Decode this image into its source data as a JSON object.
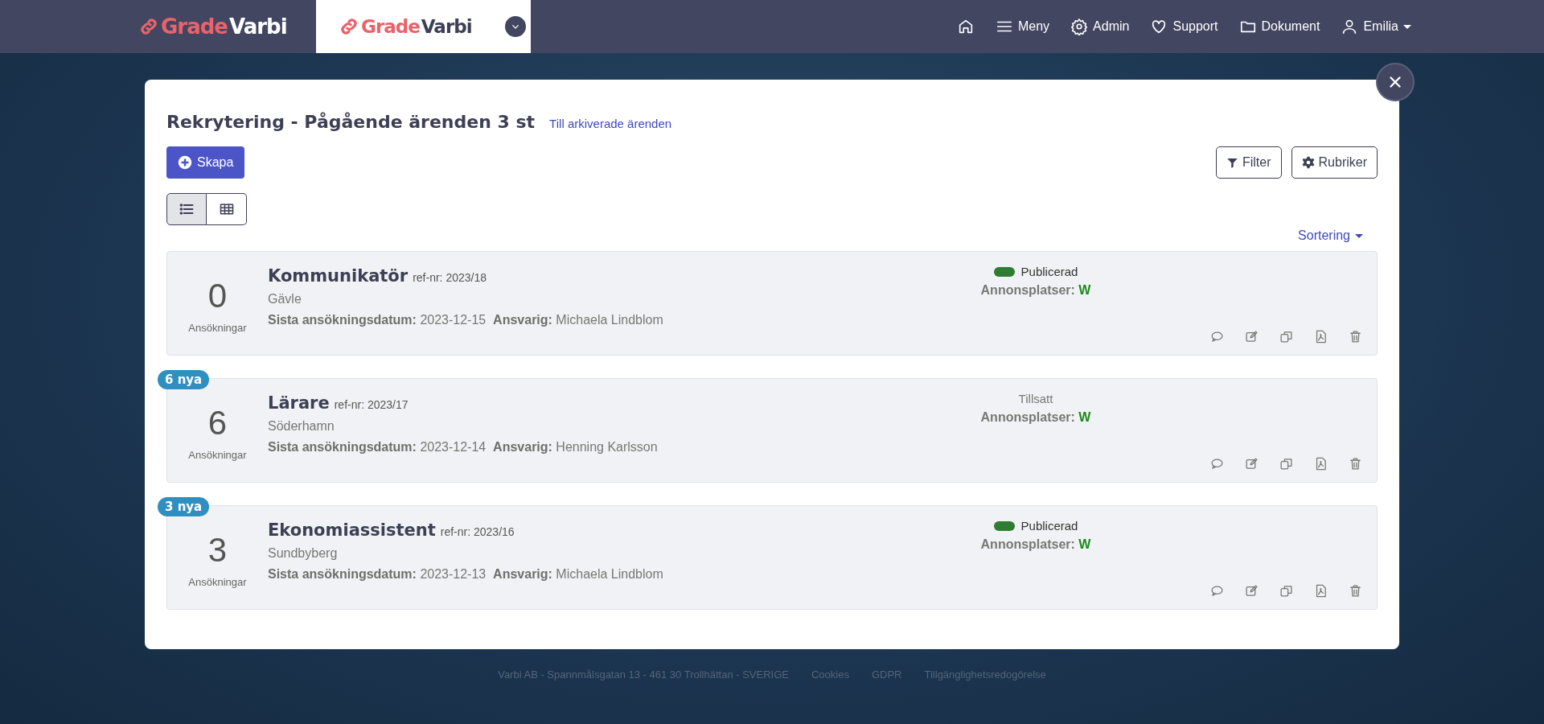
{
  "header": {
    "logo": {
      "first": "Grade",
      "second": "Varbi"
    },
    "tab_logo": {
      "first": "Grade",
      "second": "Varbi"
    },
    "nav": [
      {
        "kind": "home"
      },
      {
        "kind": "menu",
        "label": "Meny"
      },
      {
        "kind": "gear",
        "label": "Admin"
      },
      {
        "kind": "heart",
        "label": "Support"
      },
      {
        "kind": "folder",
        "label": "Dokument"
      },
      {
        "kind": "user",
        "label": "Emilia"
      }
    ]
  },
  "modal": {
    "title": "Rekrytering - Pågående ärenden 3 st",
    "archive_link": "Till arkiverade ärenden",
    "create_button": "Skapa",
    "filter_button": "Filter",
    "columns_button": "Rubriker",
    "views": [
      {
        "kind": "list",
        "selected": true
      },
      {
        "kind": "grid",
        "selected": false
      }
    ],
    "sort": "Sortering",
    "jobs": [
      {
        "count": "0",
        "count_label": "Ansökningar",
        "title": "Kommunikatör",
        "ref": "ref-nr: 2023/18",
        "location": "Gävle",
        "deadline_label": "Sista ansökningsdatum:",
        "deadline": "2023-12-15",
        "owner_label": "Ansvarig:",
        "owner": "Michaela Lindblom",
        "status": "Publicerad",
        "published": true,
        "ads_label": "Annonsplatser:",
        "ads_value": "W"
      },
      {
        "badge": "6 nya",
        "count": "6",
        "count_label": "Ansökningar",
        "title": "Lärare",
        "ref": "ref-nr: 2023/17",
        "location": "Söderhamn",
        "deadline_label": "Sista ansökningsdatum:",
        "deadline": "2023-12-14",
        "owner_label": "Ansvarig:",
        "owner": "Henning Karlsson",
        "status": "Tillsatt",
        "published": false,
        "ads_label": "Annonsplatser:",
        "ads_value": "W"
      },
      {
        "badge": "3 nya",
        "count": "3",
        "count_label": "Ansökningar",
        "title": "Ekonomiassistent",
        "ref": "ref-nr: 2023/16",
        "location": "Sundbyberg",
        "deadline_label": "Sista ansökningsdatum:",
        "deadline": "2023-12-13",
        "owner_label": "Ansvarig:",
        "owner": "Michaela Lindblom",
        "status": "Publicerad",
        "published": true,
        "ads_label": "Annonsplatser:",
        "ads_value": "W"
      }
    ]
  },
  "footer": [
    "Varbi AB - Spannmålsgatan 13 - 461 30 Trollhättan - SVERIGE",
    "Cookies",
    "GDPR",
    "Tillgänglighetsredogörelse"
  ]
}
